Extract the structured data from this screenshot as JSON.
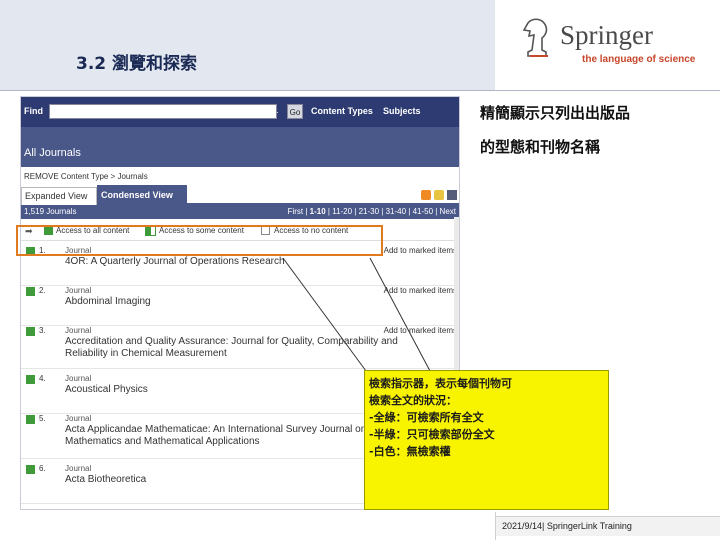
{
  "slide": {
    "title": "3.2 瀏覽和探索",
    "footer": "2021/9/14| SpringerLink Training"
  },
  "logo": {
    "name": "Springer",
    "tagline": "the language of science"
  },
  "app": {
    "find_label": "Find",
    "find_value": "",
    "ellipsis_label": "...",
    "go_label": "Go",
    "nav": [
      "Content Types",
      "Subjects"
    ],
    "section_title": "All Journals",
    "breadcrumb": "REMOVE Content Type > Journals",
    "tabs": [
      "Expanded View",
      "Condensed View"
    ],
    "count": "1,519 Journals",
    "pager": {
      "first": "First",
      "current": "1-10",
      "rest": "| 11-20 | 21-30 | 31-40 | 41-50 | Next"
    },
    "legend": {
      "full": "Access to all content",
      "some": "Access to some content",
      "none": "Access to no content"
    },
    "rows": [
      {
        "num": "1.",
        "type": "Journal",
        "title": "4OR: A Quarterly Journal of Operations Research",
        "action": "Add to marked items"
      },
      {
        "num": "2.",
        "type": "Journal",
        "title": "Abdominal Imaging",
        "action": "Add to marked items"
      },
      {
        "num": "3.",
        "type": "Journal",
        "title": "Accreditation and Quality Assurance: Journal for Quality, Comparability and Reliability in Chemical Measurement",
        "action": "Add to marked items"
      },
      {
        "num": "4.",
        "type": "Journal",
        "title": "Acoustical Physics",
        "action": ""
      },
      {
        "num": "5.",
        "type": "Journal",
        "title": "Acta Applicandae Mathematicae: An International Survey Journal on Applying Mathematics and Mathematical Applications",
        "action": ""
      },
      {
        "num": "6.",
        "type": "Journal",
        "title": "Acta Biotheoretica",
        "action": ""
      }
    ]
  },
  "note_right": [
    "精簡顯示只列出出版品",
    "的型態和刊物名稱"
  ],
  "callout": [
    "檢索指示器，表示每個刊物可",
    "檢索全文的狀況：",
    "-全綠：可檢索所有全文",
    "-半綠：只可檢索部份全文",
    "-白色：無檢索權"
  ],
  "colors": {
    "nav_dark": "#2d3b72",
    "nav_mid": "#4a5789",
    "access_green": "#3f9b3a",
    "highlight_orange": "#e07a1f",
    "callout_yellow": "#f8f400"
  }
}
